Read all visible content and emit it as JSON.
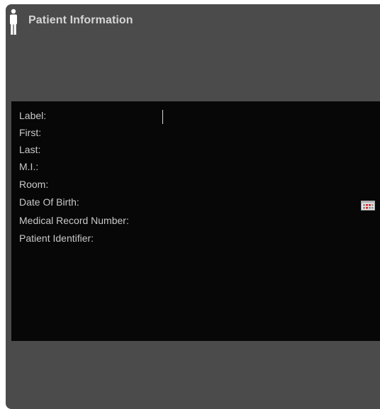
{
  "header": {
    "title": "Patient Information",
    "icon": "person-icon"
  },
  "form": {
    "fields": [
      {
        "label": "Label:",
        "value": ""
      },
      {
        "label": "First:",
        "value": ""
      },
      {
        "label": "Last:",
        "value": ""
      },
      {
        "label": "M.I.:",
        "value": ""
      },
      {
        "label": "Room:",
        "value": ""
      },
      {
        "label": "Date Of Birth:",
        "value": ""
      },
      {
        "label": "Medical Record Number:",
        "value": ""
      },
      {
        "label": "Patient Identifier:",
        "value": ""
      }
    ],
    "date_picker_icon": "calendar-icon"
  },
  "colors": {
    "panel_bg": "#4b4b4b",
    "form_bg": "#070707",
    "text": "#c9c9c9",
    "title": "#d5d5d5",
    "calendar_accent": "#d42020"
  }
}
